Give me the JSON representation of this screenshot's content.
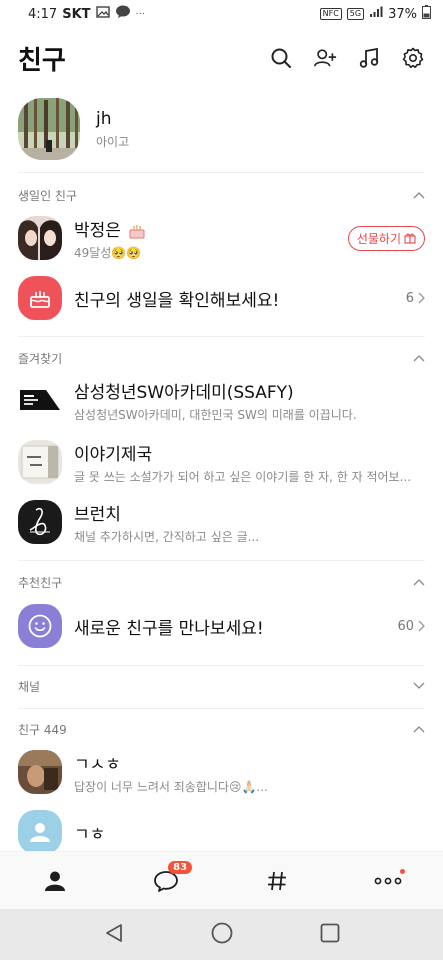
{
  "status_bar": {
    "time": "4:17",
    "carrier": "SKT",
    "more": "···",
    "nfc": "NFC",
    "network": "5G",
    "battery": "37%"
  },
  "header": {
    "title": "친구",
    "actions": [
      "search-icon",
      "add-friend-icon",
      "music-icon",
      "settings-icon"
    ]
  },
  "my_profile": {
    "name": "jh",
    "status": "아이고"
  },
  "sections": {
    "birthday": {
      "label": "생일인 친구"
    },
    "favorites": {
      "label": "즐겨찾기"
    },
    "recommended": {
      "label": "추천친구"
    },
    "channel": {
      "label": "채널"
    },
    "friends": {
      "label": "친구 449"
    }
  },
  "birthday_friend": {
    "name": "박정은",
    "status": "49달성🥺🥺",
    "gift_label": "선물하기"
  },
  "birthday_check": {
    "label": "친구의 생일을 확인해보세요!",
    "count": "6"
  },
  "favorites": [
    {
      "name": "삼성청년SW아카데미(SSAFY)",
      "status": "삼성청년SW아카데미, 대한민국 SW의 미래를 이끕니다."
    },
    {
      "name": "이야기제국",
      "status": "글 못 쓰는 소설가가 되어 하고 싶은 이야기를 한 자, 한 자 적어보..."
    },
    {
      "name": "브런치",
      "status": "채널 추가하시면, 간직하고 싶은 글..."
    }
  ],
  "recommend": {
    "label": "새로운 친구를 만나보세요!",
    "count": "60"
  },
  "friends": [
    {
      "name": "ㄱㅅㅎ",
      "status": "답장이 너무 느려서 죄송합니다😢🙏🏻..."
    },
    {
      "name": "ㄱㅎ",
      "status": ""
    }
  ],
  "bottom_nav": {
    "chat_badge": "83"
  },
  "colors": {
    "accent_red": "#e5484d",
    "birthday_icon_bg": "#f0525a",
    "recommend_icon_bg": "#8a7fd6",
    "badge": "#f4533a"
  }
}
